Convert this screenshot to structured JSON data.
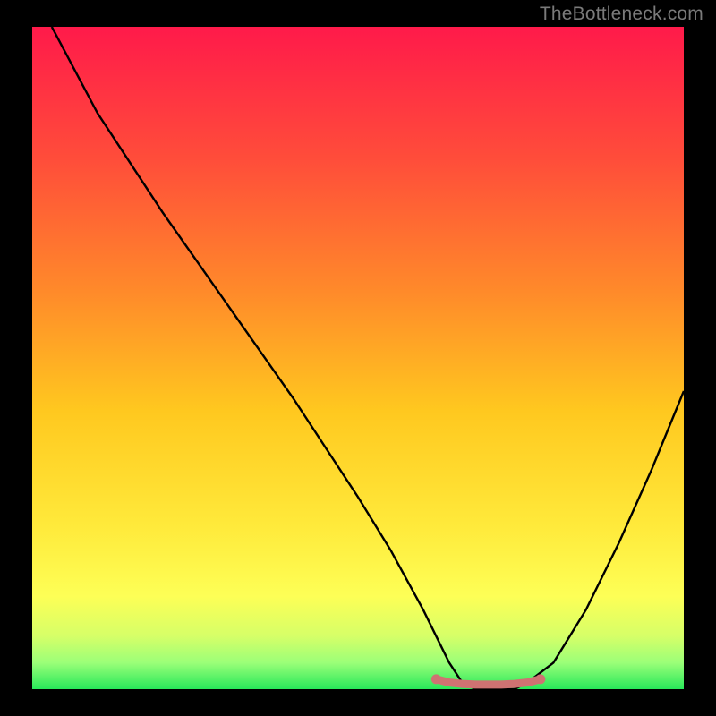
{
  "watermark": "TheBottleneck.com",
  "chart_data": {
    "type": "line",
    "title": "",
    "xlabel": "",
    "ylabel": "",
    "xlim": [
      0,
      100
    ],
    "ylim": [
      0,
      100
    ],
    "grid": false,
    "legend_position": "none",
    "series": [
      {
        "name": "bottleneck-curve",
        "color": "#000000",
        "x": [
          3,
          10,
          20,
          30,
          40,
          50,
          55,
          60,
          62,
          64,
          66,
          68,
          70,
          72,
          74,
          76,
          80,
          85,
          90,
          95,
          100
        ],
        "y": [
          100,
          87,
          72,
          58,
          44,
          29,
          21,
          12,
          8,
          4,
          1,
          0,
          0,
          0,
          0,
          1,
          4,
          12,
          22,
          33,
          45
        ]
      },
      {
        "name": "optimum-band-marker",
        "color": "#cf7272",
        "x": [
          62,
          64,
          66,
          68,
          70,
          72,
          74,
          76,
          78
        ],
        "y": [
          1.5,
          1,
          0.8,
          0.7,
          0.7,
          0.7,
          0.8,
          1,
          1.5
        ]
      }
    ],
    "gradient_stops": [
      {
        "offset": 0.0,
        "color": "#ff1a4a"
      },
      {
        "offset": 0.2,
        "color": "#ff4d3a"
      },
      {
        "offset": 0.4,
        "color": "#ff8a2a"
      },
      {
        "offset": 0.58,
        "color": "#ffc81f"
      },
      {
        "offset": 0.75,
        "color": "#ffe93a"
      },
      {
        "offset": 0.86,
        "color": "#fdff56"
      },
      {
        "offset": 0.92,
        "color": "#d6ff68"
      },
      {
        "offset": 0.96,
        "color": "#9bff78"
      },
      {
        "offset": 1.0,
        "color": "#28e85a"
      }
    ],
    "annotations": []
  }
}
